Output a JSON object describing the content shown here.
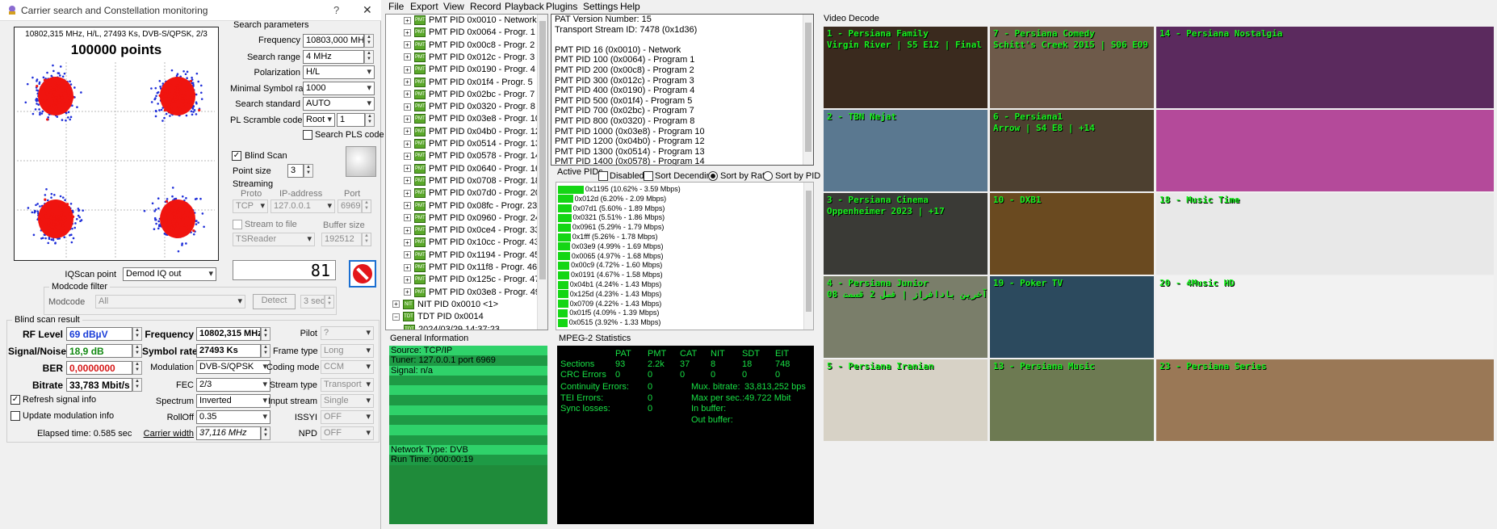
{
  "window": {
    "title": "Carrier search and Constellation monitoring",
    "help": "?",
    "close": "✕"
  },
  "constellation": {
    "header": "10802,315 MHz, H/L, 27493 Ks, DVB-S/QPSK, 2/3",
    "points": "100000 points"
  },
  "search": {
    "group": "Search parameters",
    "frequency_label": "Frequency",
    "frequency": "10803,000 MHz",
    "range_label": "Search range",
    "range": "4 MHz",
    "pol_label": "Polarization",
    "pol": "H/L",
    "msr_label": "Minimal Symbol rate",
    "msr": "1000",
    "std_label": "Search standard",
    "std": "AUTO",
    "pls_label": "PL Scramble code",
    "pls_mode": "Root",
    "pls_val": "1",
    "search_pls": "Search PLS code"
  },
  "blindscan": {
    "label": "Blind Scan",
    "checked": true,
    "point_size_label": "Point size",
    "point_size": "3"
  },
  "streaming": {
    "label": "Streaming",
    "proto_label": "Proto",
    "ip_label": "IP-address",
    "port_label": "Port",
    "proto": "TCP",
    "ip": "127.0.0.1",
    "port": "6969",
    "stream_file": "Stream to file",
    "buffer_label": "Buffer size",
    "reader": "TSReader",
    "buffer": "192512"
  },
  "iq": {
    "label": "IQScan point",
    "value": "Demod IQ out",
    "counter": "81"
  },
  "modcode": {
    "group": "Modcode filter",
    "label": "Modcode",
    "value": "All",
    "detect": "Detect",
    "time": "3 sec"
  },
  "result": {
    "group": "Blind scan result",
    "rf_label": "RF Level",
    "rf": "69 dBµV",
    "sn_label": "Signal/Noise",
    "sn": "18,9 dB",
    "ber_label": "BER",
    "ber": "0,0000000",
    "bitrate_label": "Bitrate",
    "bitrate": "33,783 Mbit/s",
    "freq_label": "Frequency",
    "freq": "10802,315 MHz",
    "sr_label": "Symbol rate",
    "sr": "27493 Ks",
    "mod_label": "Modulation",
    "mod": "DVB-S/QPSK",
    "fec_label": "FEC",
    "fec": "2/3",
    "spec_label": "Spectrum",
    "spec": "Inverted",
    "roll_label": "RollOff",
    "roll": "0.35",
    "cw_label": "Carrier width",
    "cw": "37,116 MHz",
    "pilot_label": "Pilot",
    "pilot": "?",
    "frame_label": "Frame type",
    "frame": "Long",
    "coding_label": "Coding mode",
    "coding": "CCM",
    "streamt_label": "Stream type",
    "streamt": "Transport",
    "input_label": "Input stream",
    "input": "Single",
    "issyi_label": "ISSYI",
    "issyi": "OFF",
    "npd_label": "NPD",
    "npd": "OFF",
    "refresh": "Refresh signal info",
    "update": "Update modulation info",
    "elapsed": "Elapsed time: 0.585 sec"
  },
  "menu": [
    "File",
    "Export",
    "View",
    "Record",
    "Playback",
    "Plugins",
    "Settings",
    "Help"
  ],
  "tree": [
    "PMT PID 0x0010 - Network",
    "PMT PID 0x0064 - Progr. 1",
    "PMT PID 0x00c8 - Progr. 2",
    "PMT PID 0x012c - Progr. 3",
    "PMT PID 0x0190 - Progr. 4",
    "PMT PID 0x01f4 - Progr. 5",
    "PMT PID 0x02bc - Progr. 7",
    "PMT PID 0x0320 - Progr. 8",
    "PMT PID 0x03e8 - Progr. 10",
    "PMT PID 0x04b0 - Progr. 12",
    "PMT PID 0x0514 - Progr. 13",
    "PMT PID 0x0578 - Progr. 14",
    "PMT PID 0x0640 - Progr. 16",
    "PMT PID 0x0708 - Progr. 18",
    "PMT PID 0x07d0 - Progr. 20",
    "PMT PID 0x08fc - Progr. 23",
    "PMT PID 0x0960 - Progr. 24",
    "PMT PID 0x0ce4 - Progr. 33",
    "PMT PID 0x10cc - Progr. 43",
    "PMT PID 0x1194 - Progr. 45",
    "PMT PID 0x11f8 - Progr. 46",
    "PMT PID 0x125c - Progr. 47",
    "PMT PID 0x03e8 - Progr. 49"
  ],
  "tree_tail": [
    "NIT PID 0x0010 <1>",
    "TDT PID 0x0014",
    "2024/03/29 14:37:23"
  ],
  "pat": [
    "PAT Version Number: 15",
    "Transport Stream ID: 7478 (0x1d36)",
    "",
    "PMT PID 16 (0x0010) - Network",
    "PMT PID 100 (0x0064) - Program 1",
    "PMT PID 200 (0x00c8) - Program 2",
    "PMT PID 300 (0x012c) - Program 3",
    "PMT PID 400 (0x0190) - Program 4",
    "PMT PID 500 (0x01f4) - Program 5",
    "PMT PID 700 (0x02bc) - Program 7",
    "PMT PID 800 (0x0320) - Program 8",
    "PMT PID 1000 (0x03e8) - Program 10",
    "PMT PID 1200 (0x04b0) - Program 12",
    "PMT PID 1300 (0x0514) - Program 13",
    "PMT PID 1400 (0x0578) - Program 14"
  ],
  "active": {
    "label": "Active PIDs",
    "disabled": "Disabled",
    "sort_desc": "Sort Decending",
    "sort_rate": "Sort by Rate",
    "sort_pid": "Sort by PID",
    "rows": [
      {
        "t": "0x1195 (10.62% - 3.59 Mbps)",
        "p": 10.62
      },
      {
        "t": "0x012d (6.20% - 2.09 Mbps)",
        "p": 6.2
      },
      {
        "t": "0x07d1 (5.60% - 1.89 Mbps)",
        "p": 5.6
      },
      {
        "t": "0x0321 (5.51% - 1.86 Mbps)",
        "p": 5.51
      },
      {
        "t": "0x0961 (5.29% - 1.79 Mbps)",
        "p": 5.29
      },
      {
        "t": "0x1fff (5.26% - 1.78 Mbps)",
        "p": 5.26
      },
      {
        "t": "0x03e9 (4.99% - 1.69 Mbps)",
        "p": 4.99
      },
      {
        "t": "0x0065 (4.97% - 1.68 Mbps)",
        "p": 4.97
      },
      {
        "t": "0x00c9 (4.72% - 1.60 Mbps)",
        "p": 4.72
      },
      {
        "t": "0x0191 (4.67% - 1.58 Mbps)",
        "p": 4.67
      },
      {
        "t": "0x04b1 (4.24% - 1.43 Mbps)",
        "p": 4.24
      },
      {
        "t": "0x125d (4.23% - 1.43 Mbps)",
        "p": 4.23
      },
      {
        "t": "0x0709 (4.22% - 1.43 Mbps)",
        "p": 4.22
      },
      {
        "t": "0x01f5 (4.09% - 1.39 Mbps)",
        "p": 4.09
      },
      {
        "t": "0x0515 (3.92% - 1.33 Mbps)",
        "p": 3.92
      }
    ]
  },
  "general": {
    "label": "General Information",
    "rows": [
      "Source: TCP/IP",
      "Tuner: 127.0.0.1 port 6969",
      "Signal: n/a",
      "",
      "",
      "",
      "",
      "",
      "",
      "",
      "Network Type: DVB",
      "Run Time: 000:00:19"
    ]
  },
  "mpeg": {
    "label": "MPEG-2 Statistics",
    "heads": [
      "PAT",
      "PMT",
      "CAT",
      "NIT",
      "SDT",
      "EIT"
    ],
    "sections_label": "Sections",
    "sections": [
      "93",
      "2.2k",
      "37",
      "8",
      "18",
      "748"
    ],
    "crc_label": "CRC Errors",
    "crc": [
      "0",
      "0",
      "0",
      "0",
      "0",
      "0"
    ],
    "cont_label": "Continuity Errors:",
    "cont": "0",
    "tei_label": "TEI Errors:",
    "tei": "0",
    "sync_label": "Sync losses:",
    "sync": "0",
    "mux_label": "Mux. bitrate:",
    "mux": "33,813,252 bps",
    "max_label": "Max per sec.:",
    "max": "49.722 Mbit",
    "inbuf_label": "In buffer:",
    "outbuf_label": "Out buffer:"
  },
  "video": {
    "label": "Video Decode",
    "tiles": [
      {
        "cap": "1 - Persiana Family\nVirgin River | S5 E12 | Final | +14",
        "bg": "#3a2a1e"
      },
      {
        "cap": "7 - Persiana Comedy\nSchitt's Creek 2015 | S06 E09 | +14",
        "bg": "#6e5a4a"
      },
      {
        "cap": "14 - Persiana Nostalgia",
        "bg": "#5b2a5e"
      },
      {
        "cap": "2 - TBN Nejat",
        "bg": "#5a7890"
      },
      {
        "cap": "6 - Persiana1\nArrow | S4 E8 | +14",
        "bg": "#4d4030"
      },
      {
        "cap": "",
        "bg": "#b44a9a"
      },
      {
        "cap": "3 - Persiana Cinema\nOppenheimer 2023 | +17",
        "bg": "#3a3a36"
      },
      {
        "cap": "10 - DXB1",
        "bg": "#6a4a20"
      },
      {
        "cap": "18 - Music Time",
        "bg": "#e8e8e8"
      },
      {
        "cap": "4 - Persiana Junior\nآواتار : آخرین بادافراز | فصل 2 قسمت 08 |",
        "bg": "#7a7e6a"
      },
      {
        "cap": "19 - Poker TV",
        "bg": "#2c4a5e"
      },
      {
        "cap": "20 - 4Music HD",
        "bg": "#f2f2f2"
      },
      {
        "cap": "5 - Persiana Iranian",
        "bg": "#d7d2c6"
      },
      {
        "cap": "13 - Persiana Music",
        "bg": "#6d7a52"
      },
      {
        "cap": "23 - Persiana Series",
        "bg": "#9a7856"
      }
    ]
  }
}
